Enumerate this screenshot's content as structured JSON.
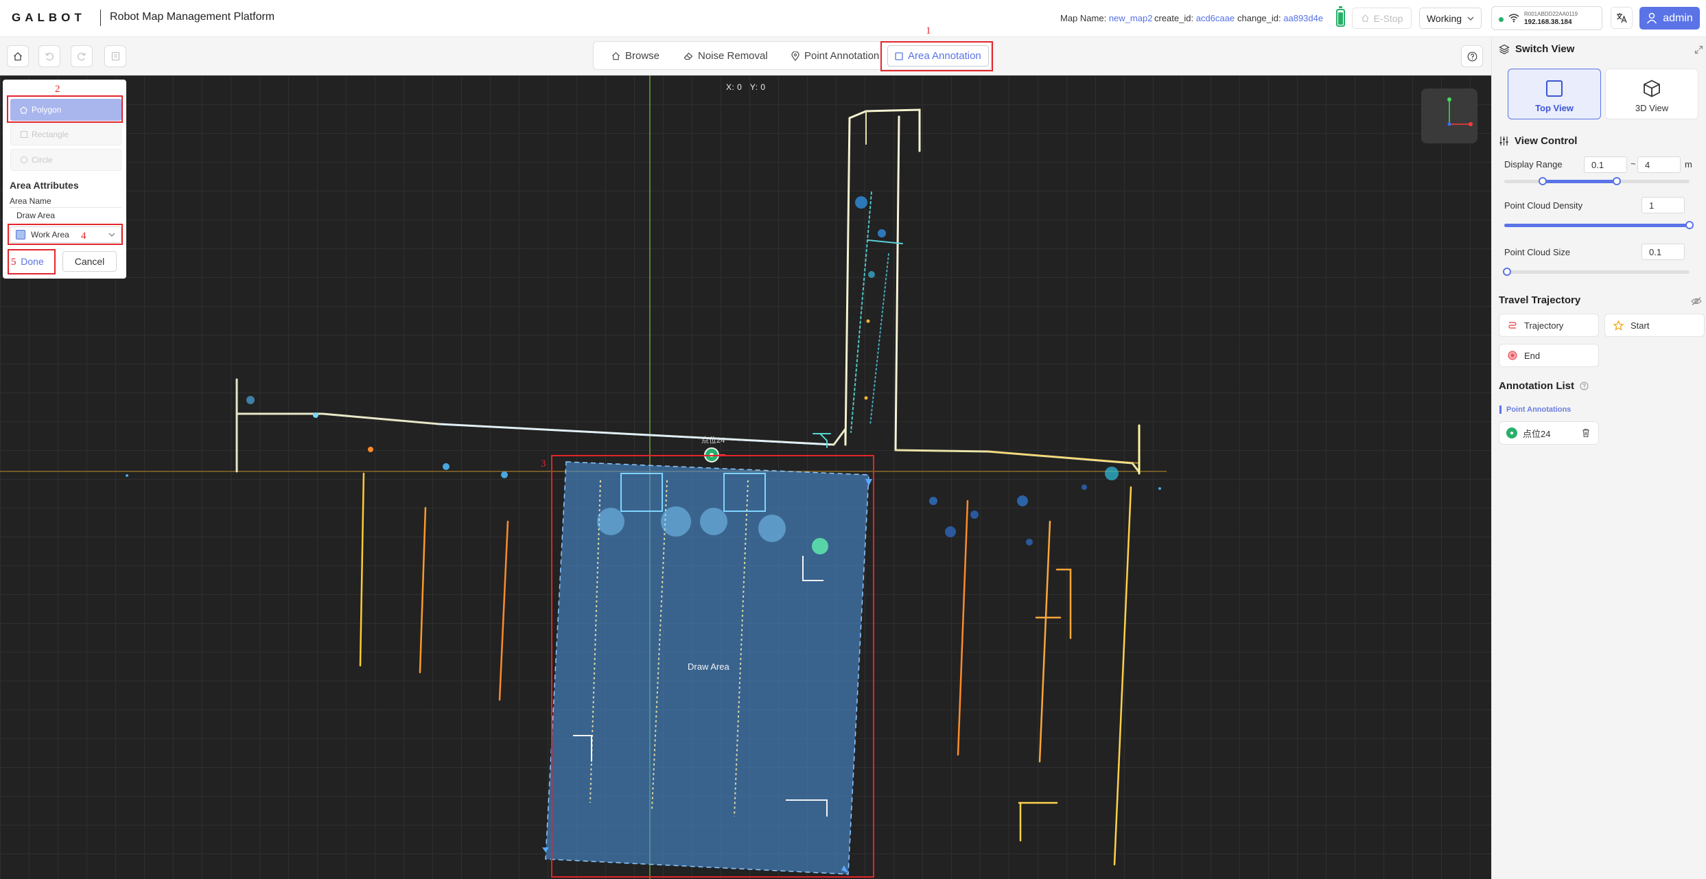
{
  "header": {
    "logo": "GALBOT",
    "title": "Robot Map Management Platform",
    "map_name_label": "Map Name:",
    "map_name": "new_map2",
    "create_id_label": "create_id:",
    "create_id": "acd6caae",
    "change_id_label": "change_id:",
    "change_id": "aa893d4e",
    "estop": "E-Stop",
    "status": "Working",
    "robot_sn": "R001ABDD22AA0119",
    "ip": "192.168.38.184",
    "user": "admin"
  },
  "toolbar": {
    "tabs": [
      {
        "label": "Browse"
      },
      {
        "label": "Noise Removal"
      },
      {
        "label": "Point Annotation"
      },
      {
        "label": "Area Annotation"
      }
    ],
    "active_tab": "Area Annotation"
  },
  "canvas": {
    "coord_x": "X: 0",
    "coord_y": "Y: 0",
    "area_label": "Draw Area",
    "point_label": "点位24"
  },
  "draw_panel": {
    "shapes": [
      {
        "label": "Polygon",
        "state": "selected"
      },
      {
        "label": "Rectangle",
        "state": "disabled"
      },
      {
        "label": "Circle",
        "state": "disabled"
      }
    ],
    "attributes_title": "Area Attributes",
    "area_name_label": "Area Name",
    "area_name_value": "Draw Area",
    "area_type": "Work Area",
    "done": "Done",
    "cancel": "Cancel"
  },
  "markers": [
    "1",
    "2",
    "3",
    "4",
    "5"
  ],
  "side": {
    "switch_view": "Switch View",
    "views": [
      {
        "label": "Top View",
        "active": true
      },
      {
        "label": "3D View",
        "active": false
      }
    ],
    "view_control": "View Control",
    "display_range_label": "Display Range",
    "range_min": "0.1",
    "range_sep": "~",
    "range_max": "4",
    "range_unit": "m",
    "density_label": "Point Cloud Density",
    "density_value": "1",
    "size_label": "Point Cloud Size",
    "size_value": "0.1",
    "trajectory_title": "Travel Trajectory",
    "trajectory_buttons": [
      {
        "label": "Trajectory"
      },
      {
        "label": "Start"
      },
      {
        "label": "End"
      }
    ],
    "annotation_title": "Annotation List",
    "point_annotations": "Point Annotations",
    "annotations": [
      {
        "label": "点位24"
      }
    ]
  },
  "colors": {
    "accent": "#5a73e6",
    "marker": "#e3242b",
    "area_fill": "#4a8fd6",
    "canvas_bg": "#222222"
  }
}
